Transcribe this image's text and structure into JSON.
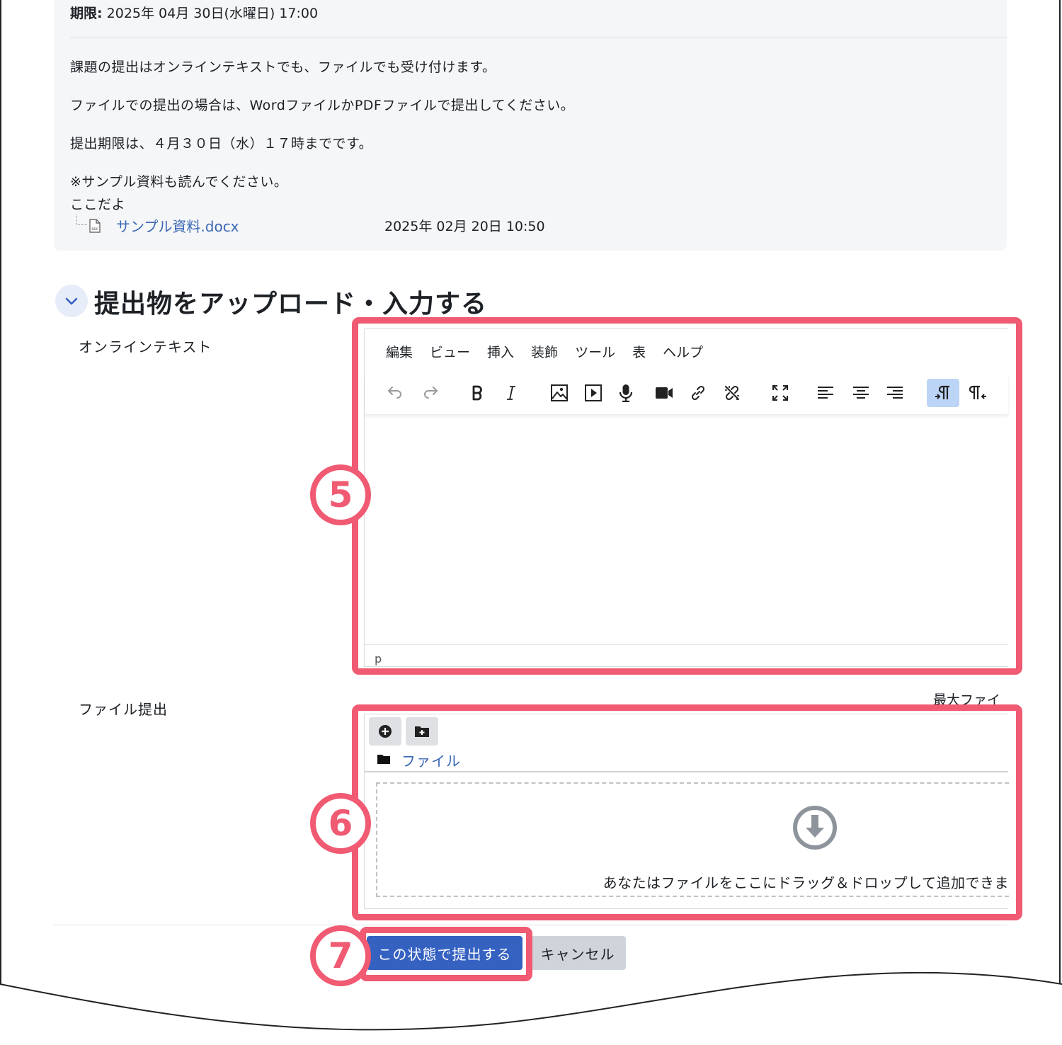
{
  "description": {
    "due_label": "期限:",
    "due_value": "2025年 04月 30日(水曜日) 17:00",
    "lines": [
      "課題の提出はオンラインテキストでも、ファイルでも受け付けます。",
      "ファイルでの提出の場合は、WordファイルかPDFファイルで提出してください。",
      "提出期限は、４月３０日（水）１７時までです。",
      "※サンプル資料も読んでください。",
      "ここだよ"
    ],
    "attachment": {
      "name": "サンプル資料.docx",
      "date": "2025年 02月 20日 10:50",
      "icon_text": "DOC"
    }
  },
  "section": {
    "title": "提出物をアップロード・入力する"
  },
  "online_text": {
    "label": "オンラインテキスト",
    "menus": [
      "編集",
      "ビュー",
      "挿入",
      "装飾",
      "ツール",
      "表",
      "ヘルプ"
    ],
    "toolbar": [
      {
        "name": "undo-icon",
        "glyph": "undo"
      },
      {
        "name": "redo-icon",
        "glyph": "redo"
      },
      {
        "name": "bold-icon",
        "glyph": "B"
      },
      {
        "name": "italic-icon",
        "glyph": "I"
      },
      {
        "name": "image-icon",
        "glyph": "image"
      },
      {
        "name": "media-icon",
        "glyph": "media"
      },
      {
        "name": "microphone-icon",
        "glyph": "mic"
      },
      {
        "name": "video-camera-icon",
        "glyph": "video"
      },
      {
        "name": "link-icon",
        "glyph": "link"
      },
      {
        "name": "unlink-icon",
        "glyph": "unlink"
      },
      {
        "name": "fullscreen-icon",
        "glyph": "fullscreen"
      },
      {
        "name": "align-left-icon",
        "glyph": "alignleft"
      },
      {
        "name": "align-center-icon",
        "glyph": "aligncenter"
      },
      {
        "name": "align-right-icon",
        "glyph": "alignright"
      },
      {
        "name": "ltr-icon",
        "glyph": "ltr",
        "active": true
      },
      {
        "name": "rtl-icon",
        "glyph": "rtl"
      }
    ],
    "status_path": "p"
  },
  "file_submission": {
    "label": "ファイル提出",
    "max_file_label": "最大ファイ",
    "path_label": "ファイル",
    "drop_text": "あなたはファイルをここにドラッグ＆ドロップして追加できま"
  },
  "actions": {
    "submit_label": "この状態で提出する",
    "cancel_label": "キャンセル"
  },
  "annotations": {
    "editor": "5",
    "file": "6",
    "submit": "7"
  },
  "colors": {
    "highlight": "#f05a72",
    "primary": "#3562c1",
    "link": "#3a66b5"
  }
}
